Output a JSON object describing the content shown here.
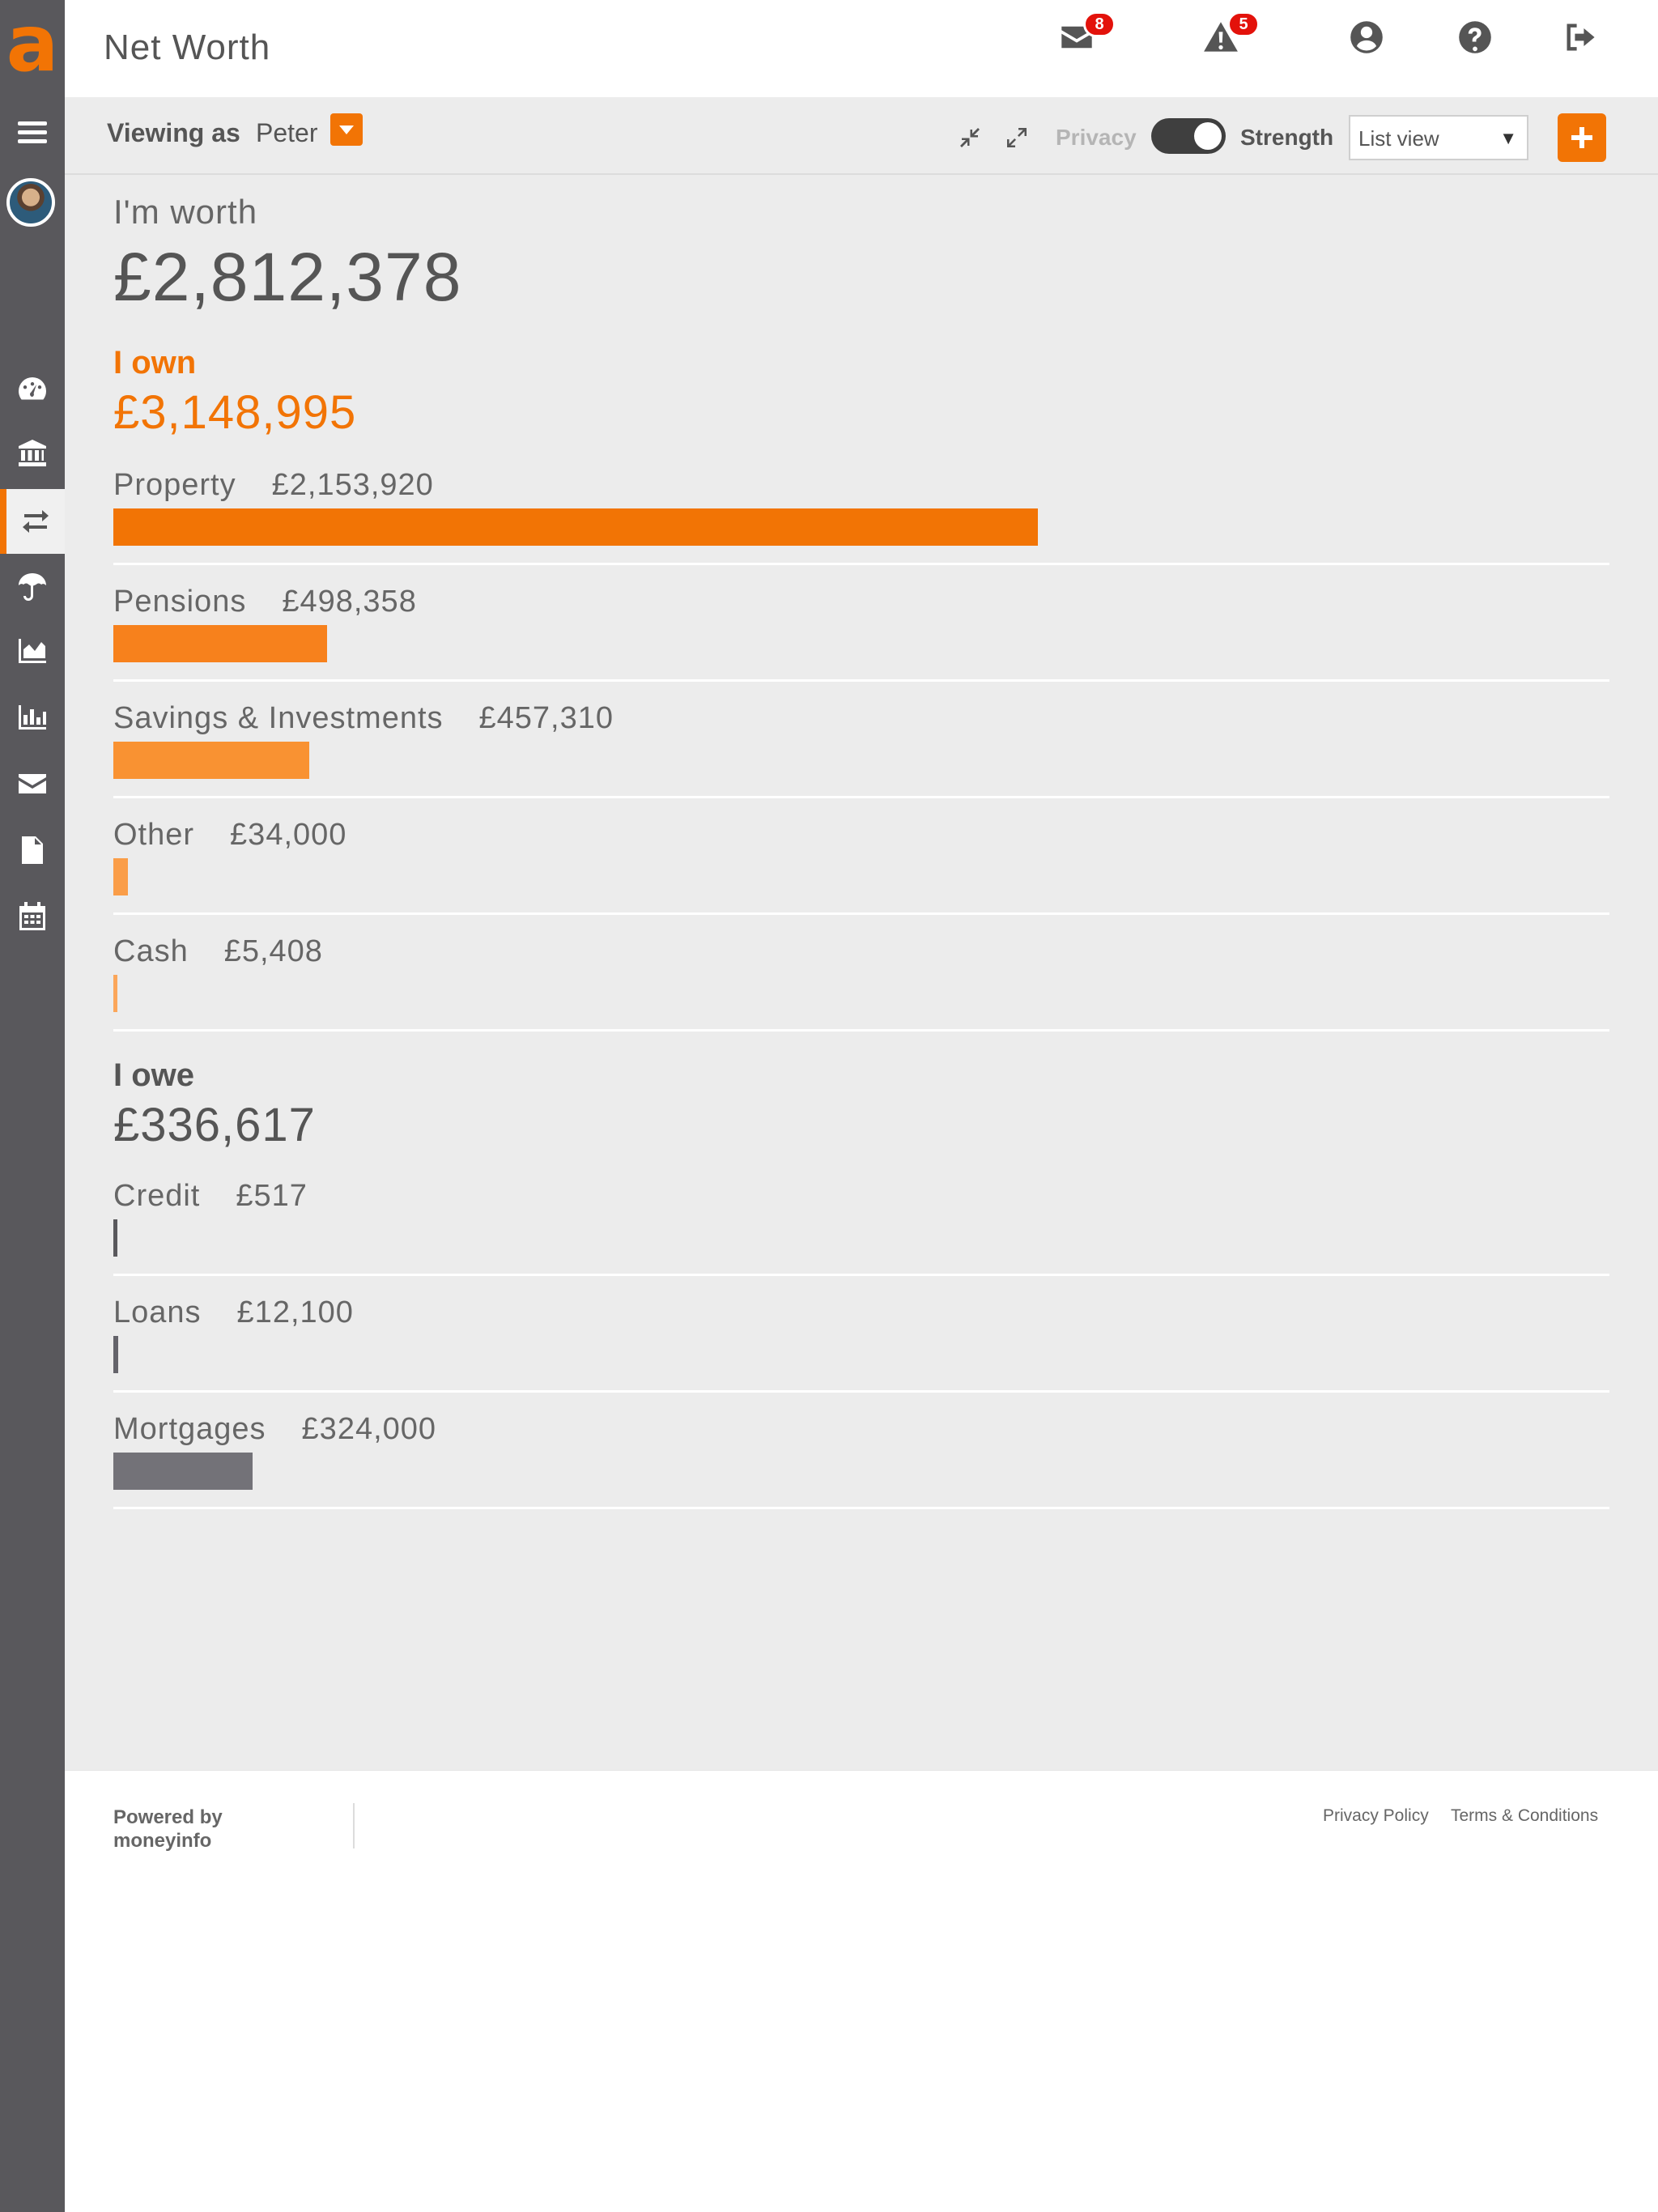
{
  "app": {
    "logo_letter": "a",
    "brand_color": "#f27405"
  },
  "header": {
    "title": "Net Worth",
    "messages_count": "8",
    "alerts_count": "5"
  },
  "toolbar": {
    "viewing_as_label": "Viewing as",
    "viewing_as_name": "Peter",
    "privacy_label": "Privacy",
    "privacy_on": true,
    "strength_label": "Strength",
    "view_select_value": "List view"
  },
  "summary": {
    "worth_label": "I'm worth",
    "worth_value": "£2,812,378"
  },
  "own": {
    "title": "I own",
    "total": "£3,148,995",
    "items": [
      {
        "label": "Property",
        "amount": "£2,153,920",
        "value": 2153920,
        "color": "#f27405"
      },
      {
        "label": "Pensions",
        "amount": "£498,358",
        "value": 498358,
        "color": "#f7811c"
      },
      {
        "label": "Savings & Investments",
        "amount": "£457,310",
        "value": 457310,
        "color": "#f99232"
      },
      {
        "label": "Other",
        "amount": "£34,000",
        "value": 34000,
        "color": "#fa9d48"
      },
      {
        "label": "Cash",
        "amount": "£5,408",
        "value": 5408,
        "color": "#fba65a"
      }
    ]
  },
  "owe": {
    "title": "I owe",
    "total": "£336,617",
    "items": [
      {
        "label": "Credit",
        "amount": "£517",
        "value": 517,
        "color": "#59585c"
      },
      {
        "label": "Loans",
        "amount": "£12,100",
        "value": 12100,
        "color": "#64636a"
      },
      {
        "label": "Mortgages",
        "amount": "£324,000",
        "value": 324000,
        "color": "#737278"
      }
    ]
  },
  "footer": {
    "powered_line1": "Powered by",
    "powered_line2": "moneyinfo",
    "privacy_policy": "Privacy Policy",
    "terms": "Terms & Conditions"
  }
}
